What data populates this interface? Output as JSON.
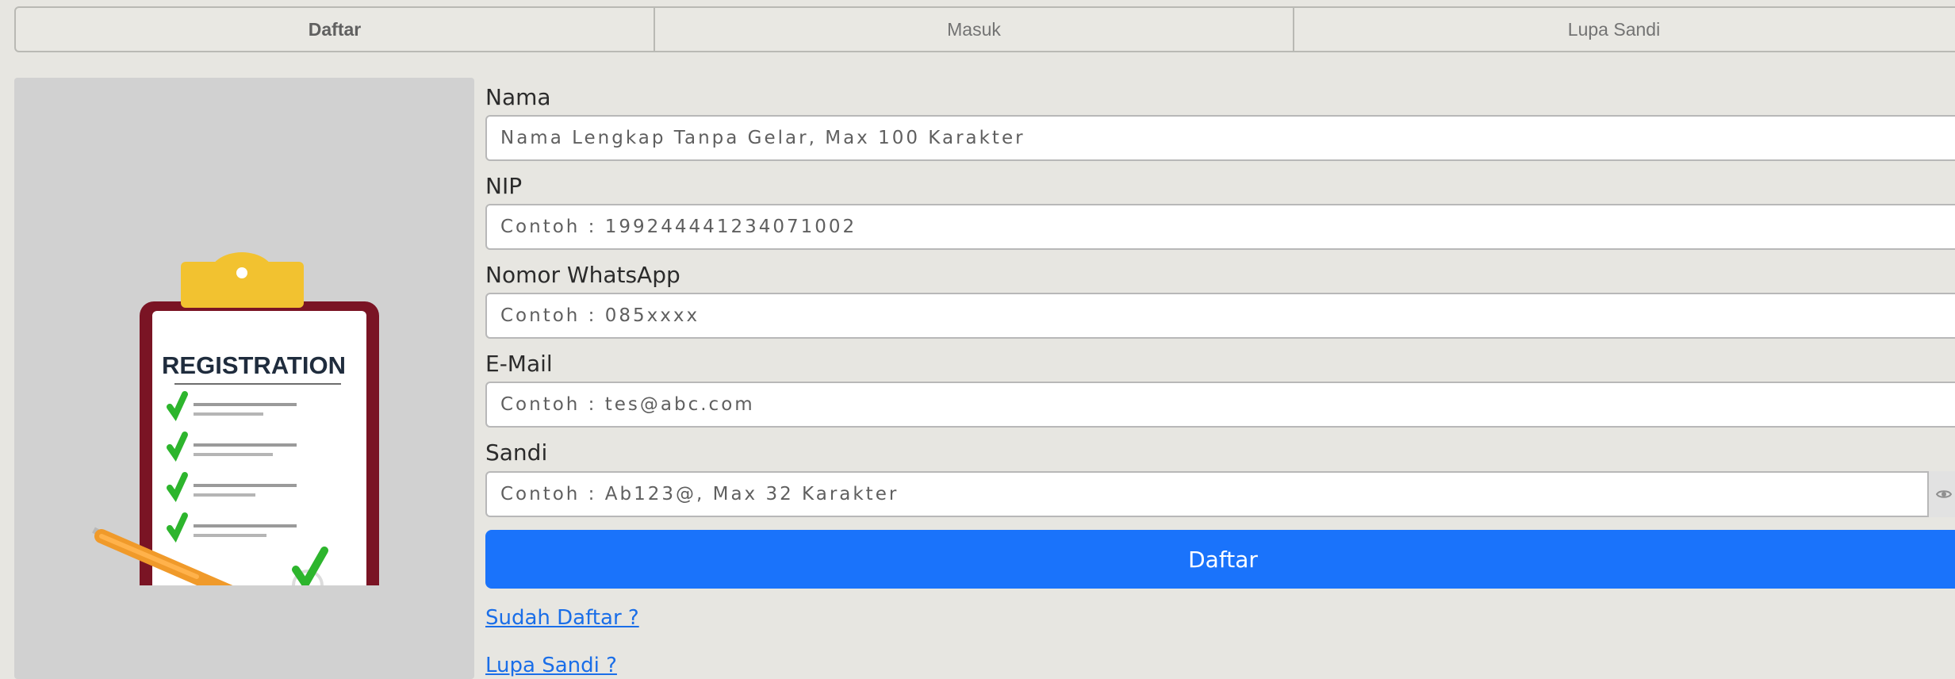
{
  "tabs": [
    {
      "label": "Daftar",
      "active": true
    },
    {
      "label": "Masuk",
      "active": false
    },
    {
      "label": "Lupa Sandi",
      "active": false
    }
  ],
  "illustration": {
    "heading": "REGISTRATION"
  },
  "form": {
    "fields": [
      {
        "label": "Nama",
        "placeholder": "Nama Lengkap Tanpa Gelar, Max 100 Karakter"
      },
      {
        "label": "NIP",
        "placeholder": "Contoh : 199244441234071002"
      },
      {
        "label": "Nomor WhatsApp",
        "placeholder": "Contoh : 085xxxx"
      },
      {
        "label": "E-Mail",
        "placeholder": "Contoh : tes@abc.com"
      },
      {
        "label": "Sandi",
        "placeholder": "Contoh : Ab123@, Max 32 Karakter"
      }
    ],
    "submit_label": "Daftar",
    "password_toggle_icon": "eye-icon"
  },
  "links": {
    "already_registered": "Sudah Daftar ?",
    "forgot_password": "Lupa Sandi ?"
  },
  "colors": {
    "background": "#e7e6e1",
    "primary_button": "#1a73fb",
    "link": "#1a6ee8",
    "clipboard_frame": "#7a1424",
    "clip": "#f2c230",
    "check": "#2db52d",
    "pencil": "#f09a2a"
  }
}
